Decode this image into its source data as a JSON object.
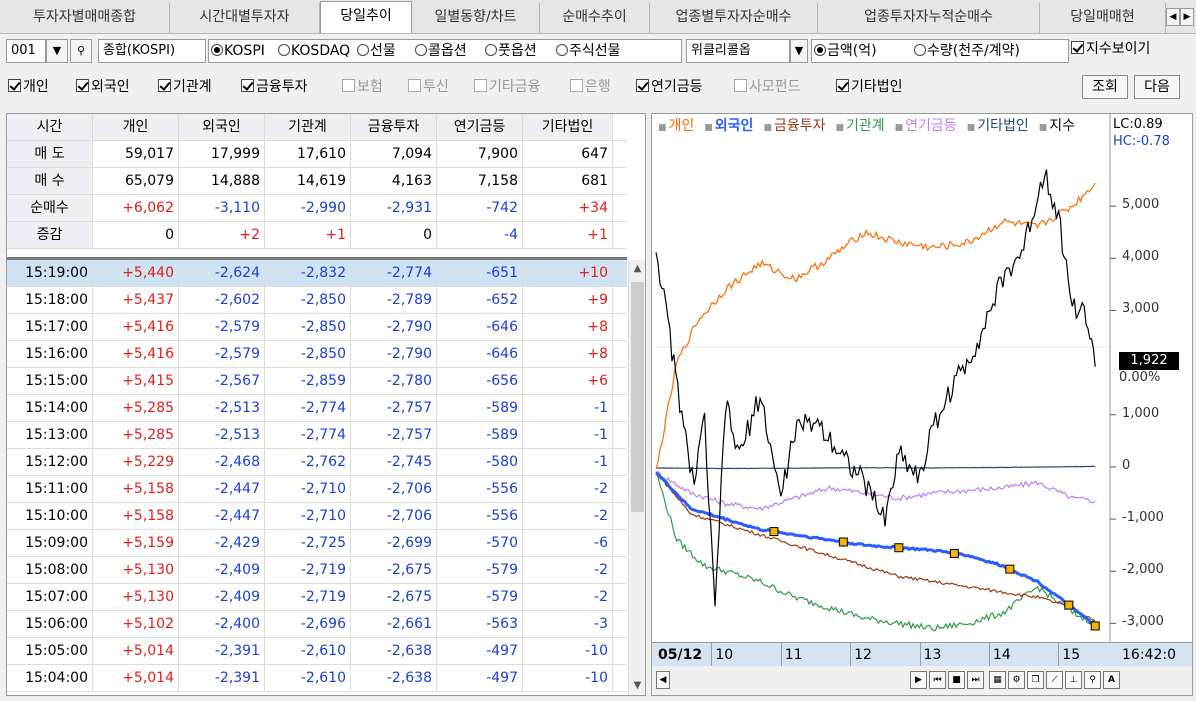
{
  "tabs": [
    "투자자별매매종합",
    "시간대별투자자",
    "당일추이",
    "일별동향/차트",
    "순매수추이",
    "업종별투자자순매수",
    "업종투자자누적순매수",
    "당일매매현"
  ],
  "active_tab": 2,
  "toolbar1": {
    "code": "001",
    "market": "종합(KOSPI)",
    "market_radios": [
      "KOSPI",
      "KOSDAQ",
      "선물",
      "콜옵션",
      "풋옵션",
      "주식선물"
    ],
    "weekly": "위클리콜옵",
    "unit_radios": [
      "금액(억)",
      "수량(천주/계약)"
    ],
    "show_index": "지수보이기"
  },
  "toolbar2": {
    "checks": [
      {
        "label": "개인",
        "on": true
      },
      {
        "label": "외국인",
        "on": true
      },
      {
        "label": "기관계",
        "on": true
      },
      {
        "label": "금융투자",
        "on": true
      },
      {
        "label": "보험",
        "on": false
      },
      {
        "label": "투신",
        "on": false
      },
      {
        "label": "기타금융",
        "on": false
      },
      {
        "label": "은행",
        "on": false
      },
      {
        "label": "연기금등",
        "on": true
      },
      {
        "label": "사모펀드",
        "on": false
      },
      {
        "label": "기타법인",
        "on": true
      }
    ],
    "query_btn": "조회",
    "next_btn": "다음"
  },
  "table": {
    "headers": [
      "시간",
      "개인",
      "외국인",
      "기관계",
      "금융투자",
      "연기금등",
      "기타법인"
    ],
    "summary": [
      {
        "label": "매 도",
        "values": [
          "59,017",
          "17,999",
          "17,610",
          "7,094",
          "7,900",
          "647"
        ]
      },
      {
        "label": "매 수",
        "values": [
          "65,079",
          "14,888",
          "14,619",
          "4,163",
          "7,158",
          "681"
        ]
      },
      {
        "label": "순매수",
        "values": [
          "+6,062",
          "-3,110",
          "-2,990",
          "-2,931",
          "-742",
          "+34"
        ]
      },
      {
        "label": "증감",
        "values": [
          "0",
          "+2",
          "+1",
          "0",
          "-4",
          "+1"
        ]
      }
    ],
    "rows": [
      [
        "15:19:00",
        "+5,440",
        "-2,624",
        "-2,832",
        "-2,774",
        "-651",
        "+10"
      ],
      [
        "15:18:00",
        "+5,437",
        "-2,602",
        "-2,850",
        "-2,789",
        "-652",
        "+9"
      ],
      [
        "15:17:00",
        "+5,416",
        "-2,579",
        "-2,850",
        "-2,790",
        "-646",
        "+8"
      ],
      [
        "15:16:00",
        "+5,416",
        "-2,579",
        "-2,850",
        "-2,790",
        "-646",
        "+8"
      ],
      [
        "15:15:00",
        "+5,415",
        "-2,567",
        "-2,859",
        "-2,780",
        "-656",
        "+6"
      ],
      [
        "15:14:00",
        "+5,285",
        "-2,513",
        "-2,774",
        "-2,757",
        "-589",
        "-1"
      ],
      [
        "15:13:00",
        "+5,285",
        "-2,513",
        "-2,774",
        "-2,757",
        "-589",
        "-1"
      ],
      [
        "15:12:00",
        "+5,229",
        "-2,468",
        "-2,762",
        "-2,745",
        "-580",
        "-1"
      ],
      [
        "15:11:00",
        "+5,158",
        "-2,447",
        "-2,710",
        "-2,706",
        "-556",
        "-2"
      ],
      [
        "15:10:00",
        "+5,158",
        "-2,447",
        "-2,710",
        "-2,706",
        "-556",
        "-2"
      ],
      [
        "15:09:00",
        "+5,159",
        "-2,429",
        "-2,725",
        "-2,699",
        "-570",
        "-6"
      ],
      [
        "15:08:00",
        "+5,130",
        "-2,409",
        "-2,719",
        "-2,675",
        "-579",
        "-2"
      ],
      [
        "15:07:00",
        "+5,130",
        "-2,409",
        "-2,719",
        "-2,675",
        "-579",
        "-2"
      ],
      [
        "15:06:00",
        "+5,102",
        "-2,400",
        "-2,696",
        "-2,661",
        "-563",
        "-3"
      ],
      [
        "15:05:00",
        "+5,014",
        "-2,391",
        "-2,610",
        "-2,638",
        "-497",
        "-10"
      ],
      [
        "15:04:00",
        "+5,014",
        "-2,391",
        "-2,610",
        "-2,638",
        "-497",
        "-10"
      ]
    ]
  },
  "chart_data": {
    "type": "line",
    "legend": [
      {
        "name": "개인",
        "color": "#ff6a00"
      },
      {
        "name": "외국인",
        "color": "#2a5cff"
      },
      {
        "name": "금융투자",
        "color": "#9b3a12"
      },
      {
        "name": "기관계",
        "color": "#2e9a4a"
      },
      {
        "name": "연기금등",
        "color": "#c07ef2"
      },
      {
        "name": "기타법인",
        "color": "#1f4a7a"
      },
      {
        "name": "지수",
        "color": "#000000"
      }
    ],
    "lc": "LC:0.89",
    "hc": "HC:-0.78",
    "yticks": [
      "5,000",
      "4,000",
      "3,000",
      "1,000",
      "0",
      "-1,000",
      "-2,000",
      "-3,000"
    ],
    "last_value": "1,922",
    "pct": "0.00%",
    "x_date": "05/12",
    "xticks": [
      "10",
      "11",
      "12",
      "13",
      "14",
      "15"
    ],
    "time": "16:42:0",
    "ylim": [
      -3300,
      6000
    ],
    "series": [
      {
        "name": "개인",
        "x": [
          9.0,
          9.3,
          9.6,
          10.0,
          10.5,
          11.0,
          11.5,
          12.0,
          12.5,
          13.0,
          13.5,
          14.0,
          14.5,
          15.0,
          15.33
        ],
        "values": [
          -100,
          2000,
          2800,
          3400,
          3900,
          3600,
          4000,
          4500,
          4300,
          4200,
          4300,
          4700,
          4600,
          5000,
          5440
        ]
      },
      {
        "name": "외국인",
        "x": [
          9.0,
          9.5,
          10.0,
          10.5,
          11.0,
          11.5,
          12.0,
          12.5,
          13.0,
          13.5,
          14.0,
          14.5,
          15.0,
          15.33
        ],
        "values": [
          -100,
          -800,
          -1000,
          -1200,
          -1300,
          -1400,
          -1500,
          -1550,
          -1600,
          -1700,
          -1900,
          -2200,
          -2700,
          -3050
        ]
      },
      {
        "name": "금융투자",
        "x": [
          9.0,
          9.5,
          10.0,
          10.5,
          11.0,
          11.5,
          12.0,
          12.5,
          13.0,
          13.5,
          14.0,
          14.5,
          15.0,
          15.33
        ],
        "values": [
          -100,
          -900,
          -1100,
          -1300,
          -1500,
          -1700,
          -1900,
          -2100,
          -2200,
          -2300,
          -2400,
          -2500,
          -2700,
          -2950
        ]
      },
      {
        "name": "기관계",
        "x": [
          9.0,
          9.3,
          9.7,
          10.0,
          10.5,
          11.0,
          11.5,
          12.0,
          12.5,
          13.0,
          13.5,
          14.0,
          14.5,
          15.0,
          15.33
        ],
        "values": [
          -100,
          -1400,
          -1900,
          -2000,
          -2200,
          -2500,
          -2700,
          -2900,
          -3000,
          -3100,
          -3000,
          -2800,
          -2300,
          -2800,
          -3000
        ]
      },
      {
        "name": "연기금등",
        "x": [
          9.0,
          9.5,
          10.0,
          10.5,
          11.0,
          11.5,
          12.0,
          12.5,
          13.0,
          13.5,
          14.0,
          14.5,
          15.0,
          15.33
        ],
        "values": [
          -100,
          -500,
          -700,
          -800,
          -600,
          -400,
          -500,
          -600,
          -500,
          -450,
          -400,
          -300,
          -600,
          -650
        ]
      },
      {
        "name": "기타법인",
        "x": [
          9.0,
          10.0,
          11.0,
          12.0,
          13.0,
          14.0,
          15.0,
          15.33
        ],
        "values": [
          -20,
          -30,
          -25,
          -15,
          -20,
          -10,
          5,
          10
        ]
      },
      {
        "name": "지수",
        "x": [
          9.0,
          9.2,
          9.4,
          9.55,
          9.7,
          9.85,
          10.0,
          10.2,
          10.5,
          10.8,
          11.0,
          11.3,
          11.6,
          12.0,
          12.3,
          12.5,
          12.8,
          13.0,
          13.3,
          13.6,
          14.0,
          14.3,
          14.6,
          14.8,
          15.0,
          15.2,
          15.33
        ],
        "values": [
          4200,
          2500,
          700,
          -300,
          900,
          -2800,
          1200,
          200,
          1400,
          -600,
          700,
          900,
          400,
          -300,
          -1000,
          300,
          -200,
          800,
          1600,
          2300,
          3600,
          4200,
          5700,
          4800,
          3100,
          2900,
          1922
        ]
      }
    ]
  }
}
